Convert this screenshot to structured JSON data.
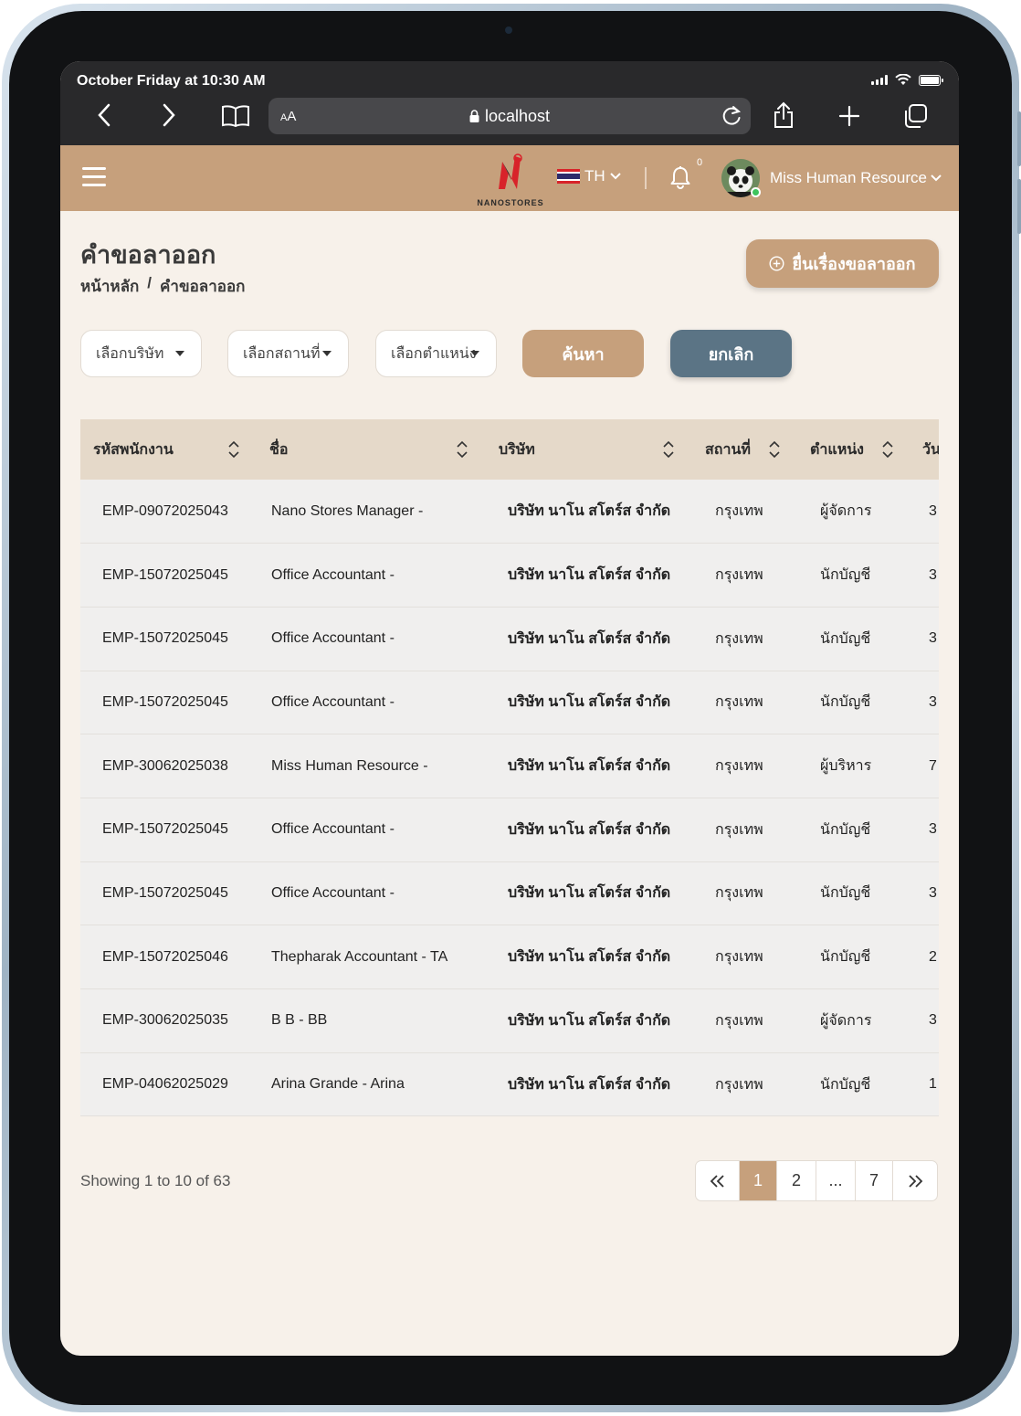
{
  "status_bar": {
    "time": "October Friday at 10:30 AM"
  },
  "browser": {
    "url": "localhost",
    "text_size_label": "AA"
  },
  "header": {
    "logo_text": "NANOSTORES",
    "language": "TH",
    "notification_count": "0",
    "user_name": "Miss Human Resource",
    "colors": {
      "brand": "#c6a07c",
      "secondary": "#5b7485"
    }
  },
  "page": {
    "title": "คำขอลาออก",
    "breadcrumb": {
      "home": "หน้าหลัก",
      "separator": "/",
      "current": "คำขอลาออก"
    },
    "create_button": "ยื่นเรื่องขอลาออก"
  },
  "filters": {
    "company": "เลือกบริษัท",
    "location": "เลือกสถานที่",
    "position": "เลือกตำแหน่ง",
    "search_button": "ค้นหา",
    "cancel_button": "ยกเลิก"
  },
  "table": {
    "columns": [
      "รหัสพนักงาน",
      "ชื่อ",
      "บริษัท",
      "สถานที่",
      "ตำแหน่ง",
      "วัน"
    ],
    "rows": [
      [
        "EMP-09072025043",
        "Nano Stores Manager -",
        "บริษัท นาโน สโตร์ส จำกัด",
        "กรุงเทพ",
        "ผู้จัดการ",
        "3"
      ],
      [
        "EMP-15072025045",
        "Office Accountant -",
        "บริษัท นาโน สโตร์ส จำกัด",
        "กรุงเทพ",
        "นักบัญชี",
        "3"
      ],
      [
        "EMP-15072025045",
        "Office Accountant -",
        "บริษัท นาโน สโตร์ส จำกัด",
        "กรุงเทพ",
        "นักบัญชี",
        "3"
      ],
      [
        "EMP-15072025045",
        "Office Accountant -",
        "บริษัท นาโน สโตร์ส จำกัด",
        "กรุงเทพ",
        "นักบัญชี",
        "3"
      ],
      [
        "EMP-30062025038",
        "Miss Human Resource -",
        "บริษัท นาโน สโตร์ส จำกัด",
        "กรุงเทพ",
        "ผู้บริหาร",
        "7"
      ],
      [
        "EMP-15072025045",
        "Office Accountant -",
        "บริษัท นาโน สโตร์ส จำกัด",
        "กรุงเทพ",
        "นักบัญชี",
        "3"
      ],
      [
        "EMP-15072025045",
        "Office Accountant -",
        "บริษัท นาโน สโตร์ส จำกัด",
        "กรุงเทพ",
        "นักบัญชี",
        "3"
      ],
      [
        "EMP-15072025046",
        "Thepharak Accountant - TA",
        "บริษัท นาโน สโตร์ส จำกัด",
        "กรุงเทพ",
        "นักบัญชี",
        "2"
      ],
      [
        "EMP-30062025035",
        "B B - BB",
        "บริษัท นาโน สโตร์ส จำกัด",
        "กรุงเทพ",
        "ผู้จัดการ",
        "3"
      ],
      [
        "EMP-04062025029",
        "Arina Grande - Arina",
        "บริษัท นาโน สโตร์ส จำกัด",
        "กรุงเทพ",
        "นักบัญชี",
        "1"
      ]
    ]
  },
  "pagination": {
    "summary": "Showing 1 to 10 of 63",
    "first": "«",
    "pages": [
      "1",
      "2",
      "...",
      "7"
    ],
    "last": "»",
    "active": "1"
  }
}
